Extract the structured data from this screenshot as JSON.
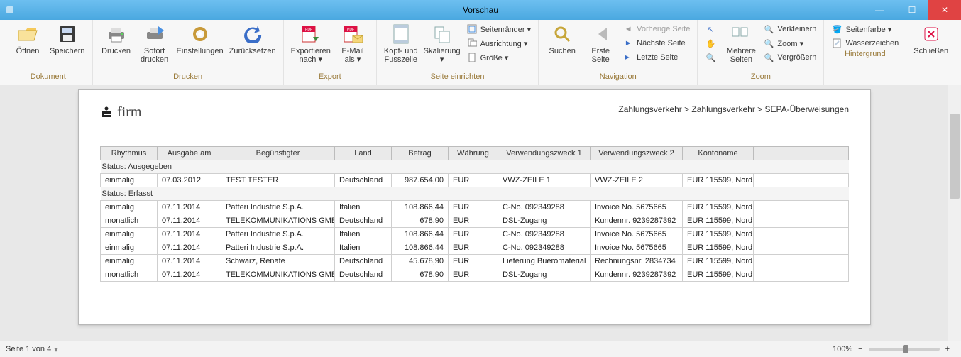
{
  "window": {
    "title": "Vorschau"
  },
  "ribbon": {
    "groups": {
      "dokument": {
        "label": "Dokument",
        "open": "Öffnen",
        "save": "Speichern"
      },
      "drucken": {
        "label": "Drucken",
        "print": "Drucken",
        "quick": "Sofort\ndrucken",
        "settings": "Einstellungen",
        "reset": "Zurücksetzen"
      },
      "export": {
        "label": "Export",
        "exportTo": "Exportieren\nnach ▾",
        "email": "E-Mail\nals ▾"
      },
      "seite": {
        "label": "Seite einrichten",
        "headfoot": "Kopf- und\nFusszeile",
        "scale": "Skalierung\n▾",
        "margins": "Seitenränder ▾",
        "align": "Ausrichtung ▾",
        "size": "Größe ▾"
      },
      "nav": {
        "label": "Navigation",
        "find": "Suchen",
        "first": "Erste\nSeite",
        "prev": "Vorherige Seite",
        "next": "Nächste Seite",
        "last": "Letzte Seite"
      },
      "zoom": {
        "label": "Zoom",
        "multi": "Mehrere\nSeiten",
        "out": "Verkleinern",
        "zoom": "Zoom ▾",
        "in": "Vergrößern",
        "pointer": "",
        "hand": ""
      },
      "bg": {
        "label": "Hintergrund",
        "pagecolor": "Seitenfarbe ▾",
        "watermark": "Wasserzeichen"
      },
      "close": {
        "label": "Schließen"
      }
    }
  },
  "page": {
    "brand_text": "firm",
    "breadcrumb": "Zahlungsverkehr > Zahlungsverkehr > SEPA-Überweisungen",
    "columns": [
      "Rhythmus",
      "Ausgabe am",
      "Begünstigter",
      "Land",
      "Betrag",
      "Währung",
      "Verwendungszweck 1",
      "Verwendungszweck 2",
      "Kontoname"
    ],
    "status1": "Status: Ausgegeben",
    "status2": "Status: Erfasst",
    "rows1": [
      {
        "r": "einmalig",
        "d": "07.03.2012",
        "b": "TEST TESTER",
        "l": "Deutschland",
        "a": "987.654,00",
        "w": "EUR",
        "v1": "VWZ-ZEILE 1",
        "v2": "VWZ-ZEILE 2",
        "k": "EUR 115599, Nord"
      }
    ],
    "rows2": [
      {
        "r": "einmalig",
        "d": "07.11.2014",
        "b": "Patteri Industrie S.p.A.",
        "l": "Italien",
        "a": "108.866,44",
        "w": "EUR",
        "v1": "C-No. 092349288",
        "v2": "Invoice No. 5675665",
        "k": "EUR 115599, Nord"
      },
      {
        "r": "monatlich",
        "d": "07.11.2014",
        "b": "TELEKOMMUNIKATIONS GMBH",
        "l": "Deutschland",
        "a": "678,90",
        "w": "EUR",
        "v1": "DSL-Zugang",
        "v2": "Kundennr. 9239287392",
        "k": "EUR 115599, Nord"
      },
      {
        "r": "einmalig",
        "d": "07.11.2014",
        "b": "Patteri Industrie S.p.A.",
        "l": "Italien",
        "a": "108.866,44",
        "w": "EUR",
        "v1": "C-No. 092349288",
        "v2": "Invoice No. 5675665",
        "k": "EUR 115599, Nord"
      },
      {
        "r": "einmalig",
        "d": "07.11.2014",
        "b": "Patteri Industrie S.p.A.",
        "l": "Italien",
        "a": "108.866,44",
        "w": "EUR",
        "v1": "C-No. 092349288",
        "v2": "Invoice No. 5675665",
        "k": "EUR 115599, Nord"
      },
      {
        "r": "einmalig",
        "d": "07.11.2014",
        "b": "Schwarz, Renate",
        "l": "Deutschland",
        "a": "45.678,90",
        "w": "EUR",
        "v1": "Lieferung Bueromaterial",
        "v2": "Rechnungsnr. 2834734",
        "k": "EUR 115599, Nord"
      },
      {
        "r": "monatlich",
        "d": "07.11.2014",
        "b": "TELEKOMMUNIKATIONS GMBH",
        "l": "Deutschland",
        "a": "678,90",
        "w": "EUR",
        "v1": "DSL-Zugang",
        "v2": "Kundennr. 9239287392",
        "k": "EUR 115599, Nord"
      }
    ]
  },
  "status": {
    "page": "Seite 1 von 4",
    "zoom": "100%"
  }
}
